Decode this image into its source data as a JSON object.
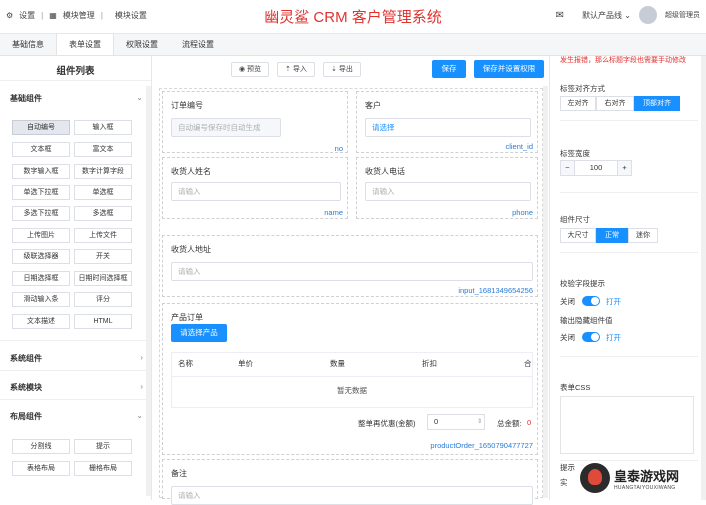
{
  "topbar": {
    "settings": "设置",
    "module_manage": "模块管理",
    "module_settings": "模块设置",
    "app_title": "幽灵鲨 CRM 客户管理系统",
    "product_line": "默认产品线",
    "username": "超级管理员"
  },
  "tabs": [
    "基础信息",
    "表单设置",
    "权限设置",
    "流程设置"
  ],
  "left": {
    "title": "组件列表",
    "basic_group": "基础组件",
    "components": [
      "自动编号",
      "输入框",
      "文本框",
      "富文本",
      "数字输入框",
      "数字计算字段",
      "单选下拉框",
      "单选框",
      "多选下拉框",
      "多选框",
      "上传图片",
      "上传文件",
      "级联选择器",
      "开关",
      "日期选择框",
      "日期时间选择框",
      "滑动输入条",
      "评分",
      "文本描述",
      "HTML"
    ],
    "system_components": "系统组件",
    "system_modules": "系统模块",
    "layout_group": "布局组件",
    "layout_components": [
      "分割线",
      "提示",
      "表格布局",
      "栅格布局"
    ]
  },
  "toolbar": {
    "preview": "预览",
    "import": "导入",
    "export": "导出",
    "save": "保存",
    "save_perm": "保存并设置权限"
  },
  "form": {
    "order_no_label": "订单编号",
    "order_no_placeholder": "自动编号保存时自动生成",
    "order_no_field": "no",
    "customer_label": "客户",
    "customer_value": "请选择",
    "customer_field": "client_id",
    "receiver_name_label": "收货人姓名",
    "receiver_name_placeholder": "请输入",
    "receiver_name_field": "name",
    "receiver_phone_label": "收货人电话",
    "receiver_phone_placeholder": "请输入",
    "receiver_phone_field": "phone",
    "address_label": "收货人地址",
    "address_placeholder": "请输入",
    "address_field": "input_1681349654256",
    "product_label": "产品订单",
    "select_product": "请选择产品",
    "table_headers": [
      "名称",
      "单价",
      "数量",
      "折扣",
      "合"
    ],
    "empty_text": "暂无数据",
    "discount_label": "整单再优惠(金额)",
    "discount_value": "0",
    "total_label": "总金额:",
    "total_value": "0",
    "product_field": "productOrder_1650790477727",
    "remark_label": "备注",
    "remark_placeholder": "请输入"
  },
  "right": {
    "hint": "发生报错，那么标题字段也需要手动修改",
    "label_align": "标签对齐方式",
    "align_options": [
      "左对齐",
      "右对齐",
      "顶部对齐"
    ],
    "label_width": "标签宽度",
    "width_value": "100",
    "size_label": "组件尺寸",
    "size_options": [
      "大尺寸",
      "正常",
      "迷你"
    ],
    "validation": "校验字段提示",
    "off1": "关闭",
    "on1": "打开",
    "hide_label": "输出隐藏组件值",
    "off2": "关闭",
    "on2": "打开",
    "css_label": "表单CSS",
    "tip_label": "提示",
    "tip_sub": "实"
  },
  "watermark": {
    "name": "皇泰游戏网",
    "url": "HUANGTAIYOUXIWANG"
  },
  "colors": {
    "primary": "#1890ff",
    "title_red": "#e0322f"
  }
}
